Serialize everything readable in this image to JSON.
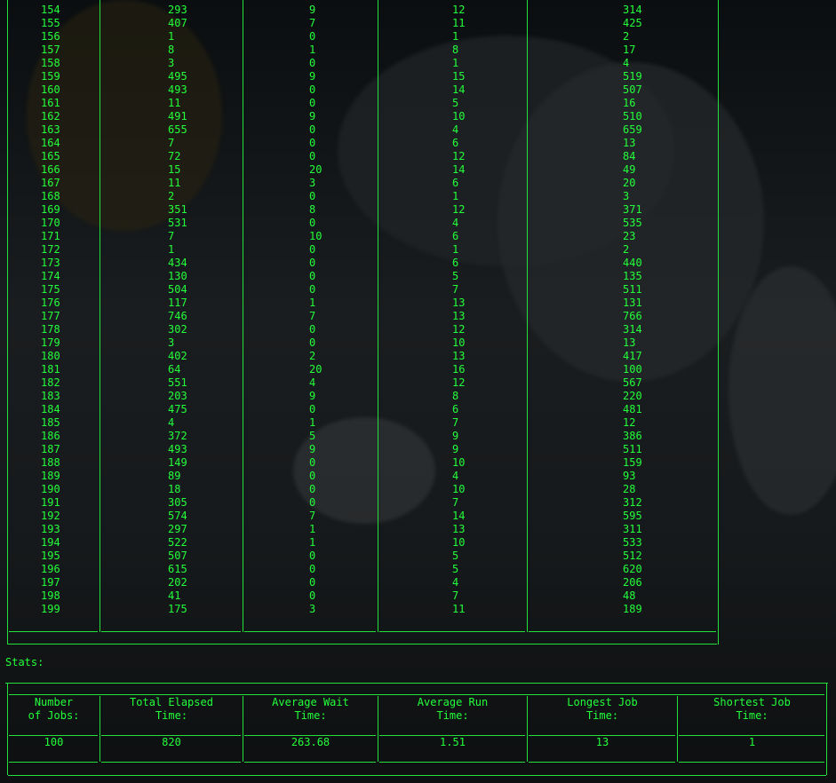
{
  "job_rows": [
    [
      "154",
      "293",
      "9",
      "12",
      "314"
    ],
    [
      "155",
      "407",
      "7",
      "11",
      "425"
    ],
    [
      "156",
      "1",
      "0",
      "1",
      "2"
    ],
    [
      "157",
      "8",
      "1",
      "8",
      "17"
    ],
    [
      "158",
      "3",
      "0",
      "1",
      "4"
    ],
    [
      "159",
      "495",
      "9",
      "15",
      "519"
    ],
    [
      "160",
      "493",
      "0",
      "14",
      "507"
    ],
    [
      "161",
      "11",
      "0",
      "5",
      "16"
    ],
    [
      "162",
      "491",
      "9",
      "10",
      "510"
    ],
    [
      "163",
      "655",
      "0",
      "4",
      "659"
    ],
    [
      "164",
      "7",
      "0",
      "6",
      "13"
    ],
    [
      "165",
      "72",
      "0",
      "12",
      "84"
    ],
    [
      "166",
      "15",
      "20",
      "14",
      "49"
    ],
    [
      "167",
      "11",
      "3",
      "6",
      "20"
    ],
    [
      "168",
      "2",
      "0",
      "1",
      "3"
    ],
    [
      "169",
      "351",
      "8",
      "12",
      "371"
    ],
    [
      "170",
      "531",
      "0",
      "4",
      "535"
    ],
    [
      "171",
      "7",
      "10",
      "6",
      "23"
    ],
    [
      "172",
      "1",
      "0",
      "1",
      "2"
    ],
    [
      "173",
      "434",
      "0",
      "6",
      "440"
    ],
    [
      "174",
      "130",
      "0",
      "5",
      "135"
    ],
    [
      "175",
      "504",
      "0",
      "7",
      "511"
    ],
    [
      "176",
      "117",
      "1",
      "13",
      "131"
    ],
    [
      "177",
      "746",
      "7",
      "13",
      "766"
    ],
    [
      "178",
      "302",
      "0",
      "12",
      "314"
    ],
    [
      "179",
      "3",
      "0",
      "10",
      "13"
    ],
    [
      "180",
      "402",
      "2",
      "13",
      "417"
    ],
    [
      "181",
      "64",
      "20",
      "16",
      "100"
    ],
    [
      "182",
      "551",
      "4",
      "12",
      "567"
    ],
    [
      "183",
      "203",
      "9",
      "8",
      "220"
    ],
    [
      "184",
      "475",
      "0",
      "6",
      "481"
    ],
    [
      "185",
      "4",
      "1",
      "7",
      "12"
    ],
    [
      "186",
      "372",
      "5",
      "9",
      "386"
    ],
    [
      "187",
      "493",
      "9",
      "9",
      "511"
    ],
    [
      "188",
      "149",
      "0",
      "10",
      "159"
    ],
    [
      "189",
      "89",
      "0",
      "4",
      "93"
    ],
    [
      "190",
      "18",
      "0",
      "10",
      "28"
    ],
    [
      "191",
      "305",
      "0",
      "7",
      "312"
    ],
    [
      "192",
      "574",
      "7",
      "14",
      "595"
    ],
    [
      "193",
      "297",
      "1",
      "13",
      "311"
    ],
    [
      "194",
      "522",
      "1",
      "10",
      "533"
    ],
    [
      "195",
      "507",
      "0",
      "5",
      "512"
    ],
    [
      "196",
      "615",
      "0",
      "5",
      "620"
    ],
    [
      "197",
      "202",
      "0",
      "4",
      "206"
    ],
    [
      "198",
      "41",
      "0",
      "7",
      "48"
    ],
    [
      "199",
      "175",
      "3",
      "11",
      "189"
    ]
  ],
  "stats_label": "Stats:",
  "stats_headers": [
    [
      "Number",
      "of Jobs:"
    ],
    [
      "Total Elapsed",
      "Time:"
    ],
    [
      "Average Wait",
      "Time:"
    ],
    [
      "Average Run",
      "Time:"
    ],
    [
      "Longest Job",
      "Time:"
    ],
    [
      "Shortest Job",
      "Time:"
    ]
  ],
  "stats_values": [
    "100",
    "820",
    "263.68",
    "1.51",
    "13",
    "1"
  ],
  "colors": {
    "terminal_text": "#23ff3a",
    "background": "#121517"
  }
}
